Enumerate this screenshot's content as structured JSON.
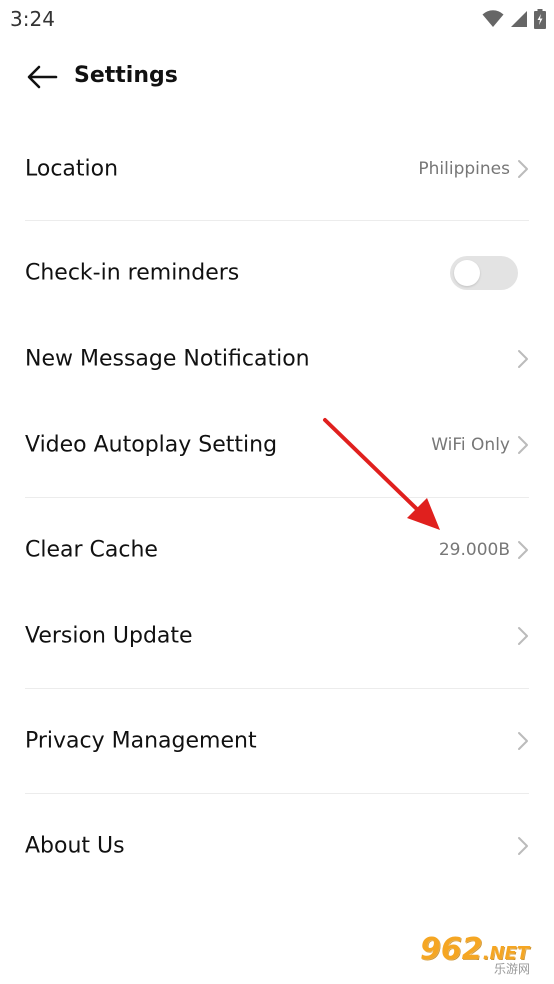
{
  "status_bar": {
    "time": "3:24",
    "icons": [
      "wifi-icon",
      "signal-icon",
      "battery-icon"
    ]
  },
  "header": {
    "title": "Settings",
    "back_icon": "arrow-left-icon"
  },
  "settings": {
    "location": {
      "label": "Location",
      "value": "Philippines"
    },
    "checkin": {
      "label": "Check-in reminders",
      "enabled": false
    },
    "new_message": {
      "label": "New Message Notification"
    },
    "video_autoplay": {
      "label": "Video Autoplay Setting",
      "value": "WiFi Only"
    },
    "clear_cache": {
      "label": "Clear Cache",
      "value": "29.000B"
    },
    "version_update": {
      "label": "Version Update"
    },
    "privacy": {
      "label": "Privacy Management"
    },
    "about": {
      "label": "About Us"
    }
  },
  "colors": {
    "annotation_arrow": "#e0201e",
    "toggle_off": "#e3e3e3",
    "divider": "#ececec",
    "value_text": "#777777"
  },
  "watermark": {
    "brand": "962",
    "suffix": ".NET",
    "subtitle": "乐游网"
  }
}
